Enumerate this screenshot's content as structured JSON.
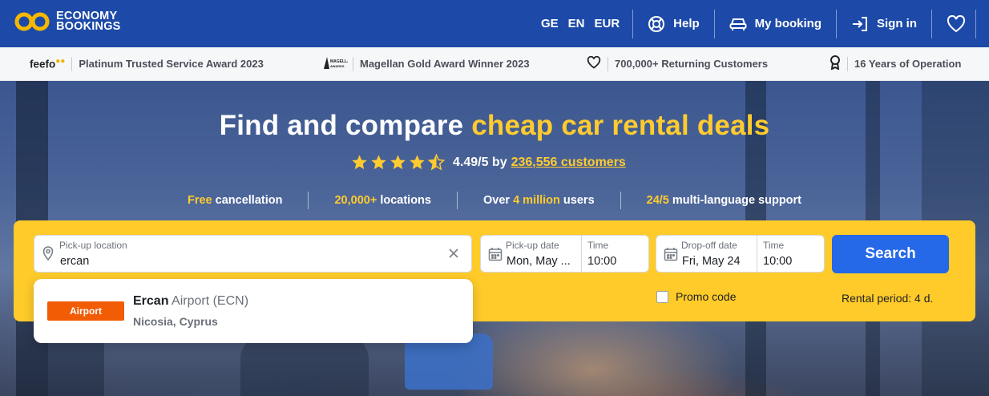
{
  "header": {
    "logo_line1": "ECONOMY",
    "logo_line2": "BOOKINGS",
    "languages": [
      "GE",
      "EN",
      "EUR"
    ],
    "help_label": "Help",
    "my_booking_label": "My booking",
    "sign_in_label": "Sign in"
  },
  "trust_bar": {
    "feefo_logo": "feefo",
    "feefo_award": "Platinum Trusted Service Award 2023",
    "magellan_award": "Magellan Gold Award Winner 2023",
    "returning_customers": "700,000+ Returning Customers",
    "years": "16 Years of Operation"
  },
  "hero": {
    "title_start": "Find and compare ",
    "title_highlight": "cheap car rental deals",
    "rating_value": "4.49/5 by",
    "rating_customers": "236,556 customers",
    "rating_stars": 4.49,
    "features": [
      {
        "highlight": "Free",
        "text": " cancellation"
      },
      {
        "highlight": "20,000+",
        "text": " locations"
      },
      {
        "prefix": "Over ",
        "highlight": "4 million",
        "text": " users"
      },
      {
        "highlight": "24/5",
        "text": " multi-language support"
      }
    ]
  },
  "search": {
    "pickup_label": "Pick-up location",
    "pickup_value": "ercan",
    "pickup_date_label": "Pick-up date",
    "pickup_date_value": "Mon, May ...",
    "pickup_time_label": "Time",
    "pickup_time_value": "10:00",
    "dropoff_date_label": "Drop-off date",
    "dropoff_date_value": "Fri, May 24",
    "dropoff_time_label": "Time",
    "dropoff_time_value": "10:00",
    "search_button": "Search",
    "promo_label": "Promo code",
    "rental_period": "Rental period: 4 d."
  },
  "suggestion": {
    "badge": "Airport",
    "name_bold": "Ercan",
    "name_rest": " Airport (ECN)",
    "location": "Nicosia, Cyprus"
  },
  "colors": {
    "brand_blue": "#1d4aa8",
    "accent_yellow": "#ffcb2f",
    "search_blue": "#2568e8",
    "badge_orange": "#f25c05"
  }
}
